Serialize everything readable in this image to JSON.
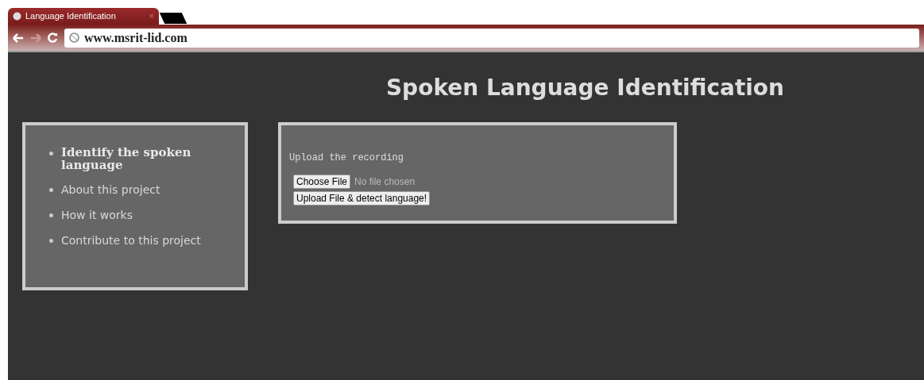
{
  "browser": {
    "tab_title": "Language Identification",
    "tab_close": "×",
    "address": "www.msrit-lid.com"
  },
  "page": {
    "title": "Spoken Language Identification",
    "nav": [
      {
        "label": "Identify the spoken language",
        "selected": true
      },
      {
        "label": "About this project",
        "selected": false
      },
      {
        "label": "How it works",
        "selected": false
      },
      {
        "label": "Contribute to this project",
        "selected": false
      }
    ],
    "upload": {
      "label": "Upload the recording",
      "choose_button": "Choose File",
      "file_status": "No file chosen",
      "submit_button": "Upload File & detect language!"
    }
  }
}
